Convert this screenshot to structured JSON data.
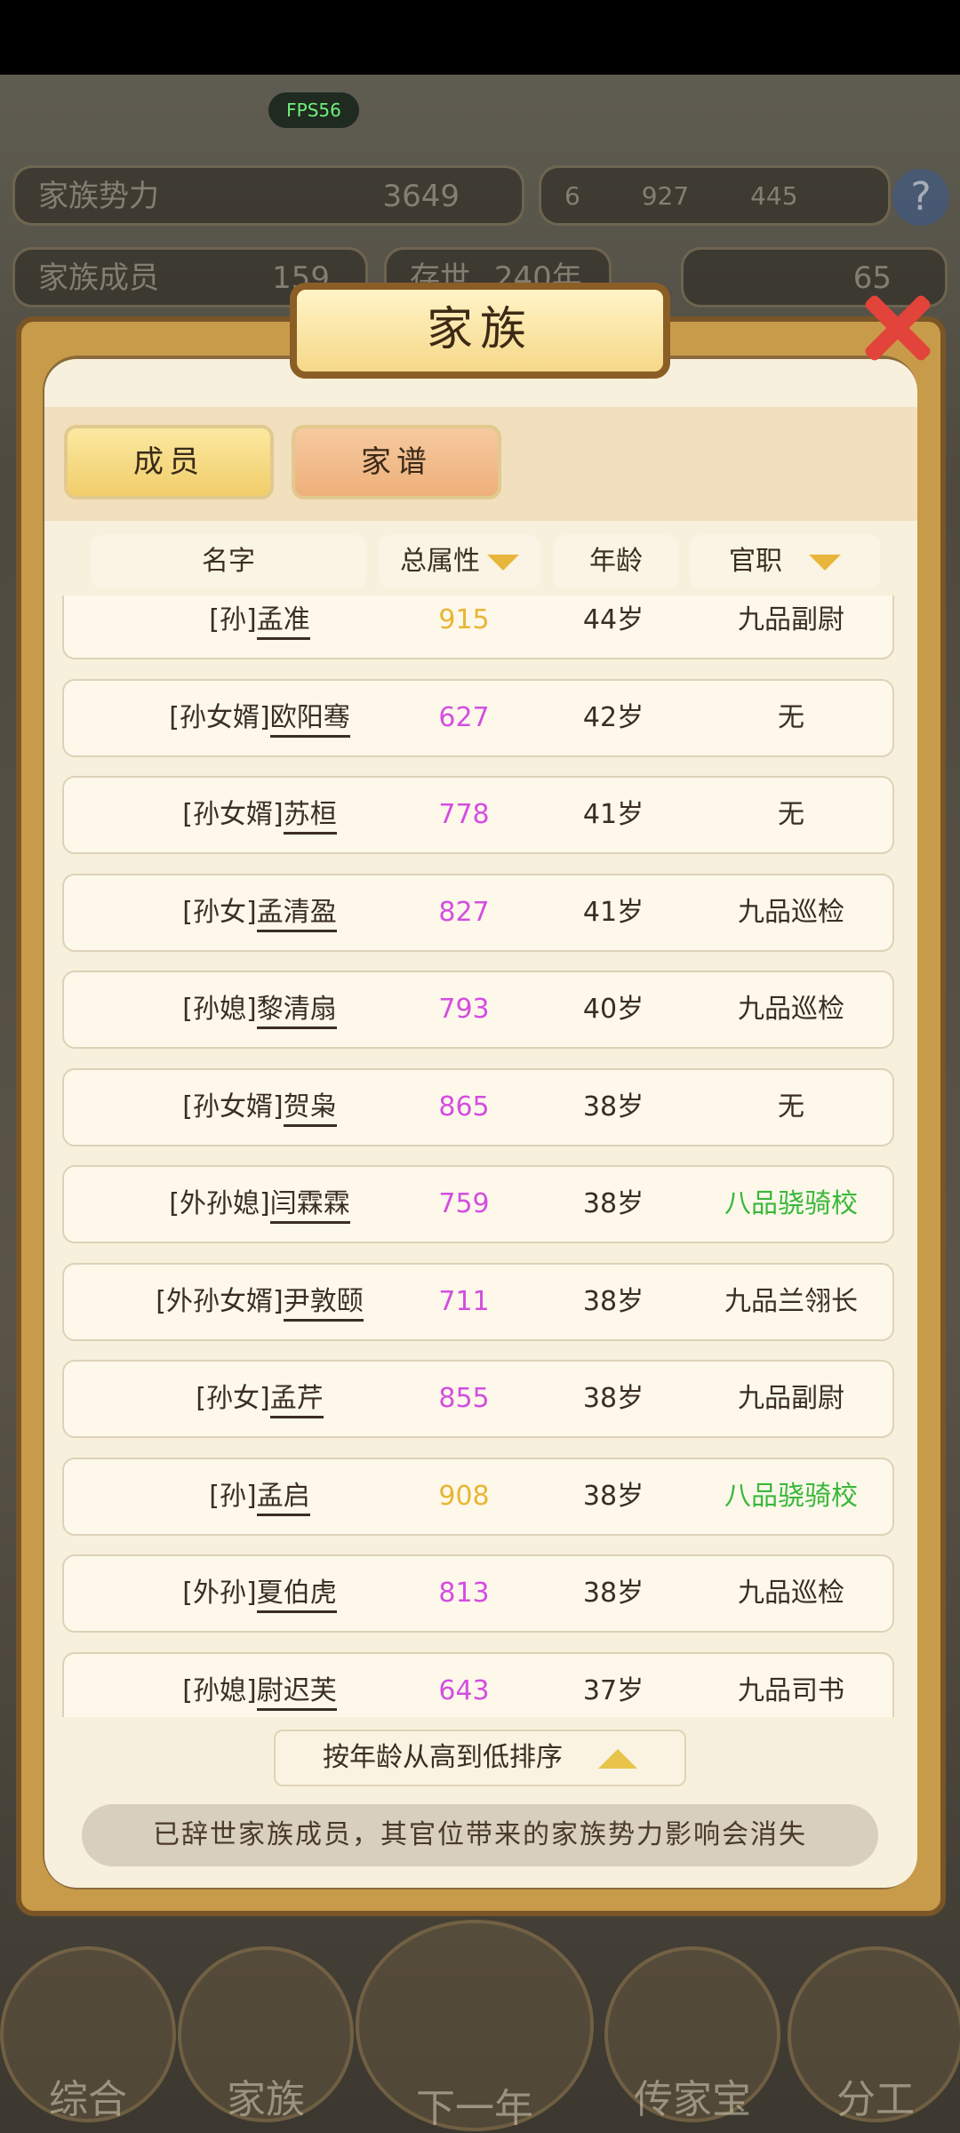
{
  "fps_label": "FPS56",
  "background": {
    "power_label": "家族势力",
    "power_value": "3649",
    "members_label": "家族成员",
    "members_value": "159",
    "years_label": "存世",
    "years_value": "240年",
    "resources": [
      "6",
      "927",
      "445"
    ],
    "ingot_value": "65",
    "help": "?"
  },
  "modal": {
    "title": "家族",
    "tabs": {
      "members": "成员",
      "genealogy": "家谱"
    },
    "headers": {
      "name": "名字",
      "attr": "总属性",
      "age": "年龄",
      "rank": "官职"
    },
    "rows": [
      {
        "prefix": "[孙]",
        "name": "孟准",
        "attr": "915",
        "attr_color": "#e8b634",
        "age": "44岁",
        "rank": "九品副尉",
        "rank_color": "#3a2e22"
      },
      {
        "prefix": "[孙女婿]",
        "name": "欧阳骞",
        "attr": "627",
        "attr_color": "#d44ee0",
        "age": "42岁",
        "rank": "无",
        "rank_color": "#3a2e22"
      },
      {
        "prefix": "[孙女婿]",
        "name": "苏桓",
        "attr": "778",
        "attr_color": "#d44ee0",
        "age": "41岁",
        "rank": "无",
        "rank_color": "#3a2e22"
      },
      {
        "prefix": "[孙女]",
        "name": "孟清盈",
        "attr": "827",
        "attr_color": "#d44ee0",
        "age": "41岁",
        "rank": "九品巡检",
        "rank_color": "#3a2e22"
      },
      {
        "prefix": "[孙媳]",
        "name": "黎清扇",
        "attr": "793",
        "attr_color": "#d44ee0",
        "age": "40岁",
        "rank": "九品巡检",
        "rank_color": "#3a2e22"
      },
      {
        "prefix": "[孙女婿]",
        "name": "贺枭",
        "attr": "865",
        "attr_color": "#d44ee0",
        "age": "38岁",
        "rank": "无",
        "rank_color": "#3a2e22"
      },
      {
        "prefix": "[外孙媳]",
        "name": "闫霖霖",
        "attr": "759",
        "attr_color": "#d44ee0",
        "age": "38岁",
        "rank": "八品骁骑校",
        "rank_color": "#3ab83a"
      },
      {
        "prefix": "[外孙女婿]",
        "name": "尹敦颐",
        "attr": "711",
        "attr_color": "#d44ee0",
        "age": "38岁",
        "rank": "九品兰翎长",
        "rank_color": "#3a2e22"
      },
      {
        "prefix": "[孙女]",
        "name": "孟芹",
        "attr": "855",
        "attr_color": "#d44ee0",
        "age": "38岁",
        "rank": "九品副尉",
        "rank_color": "#3a2e22"
      },
      {
        "prefix": "[孙]",
        "name": "孟启",
        "attr": "908",
        "attr_color": "#e8b634",
        "age": "38岁",
        "rank": "八品骁骑校",
        "rank_color": "#3ab83a"
      },
      {
        "prefix": "[外孙]",
        "name": "夏伯虎",
        "attr": "813",
        "attr_color": "#d44ee0",
        "age": "38岁",
        "rank": "九品巡检",
        "rank_color": "#3a2e22"
      },
      {
        "prefix": "[孙媳]",
        "name": "尉迟芙",
        "attr": "643",
        "attr_color": "#d44ee0",
        "age": "37岁",
        "rank": "九品司书",
        "rank_color": "#3a2e22"
      }
    ],
    "sort_label": "按年龄从高到低排序",
    "notice": "已辞世家族成员，其官位带来的家族势力影响会消失"
  },
  "nav": [
    "综合",
    "家族",
    "下一年",
    "传家宝",
    "分工"
  ]
}
